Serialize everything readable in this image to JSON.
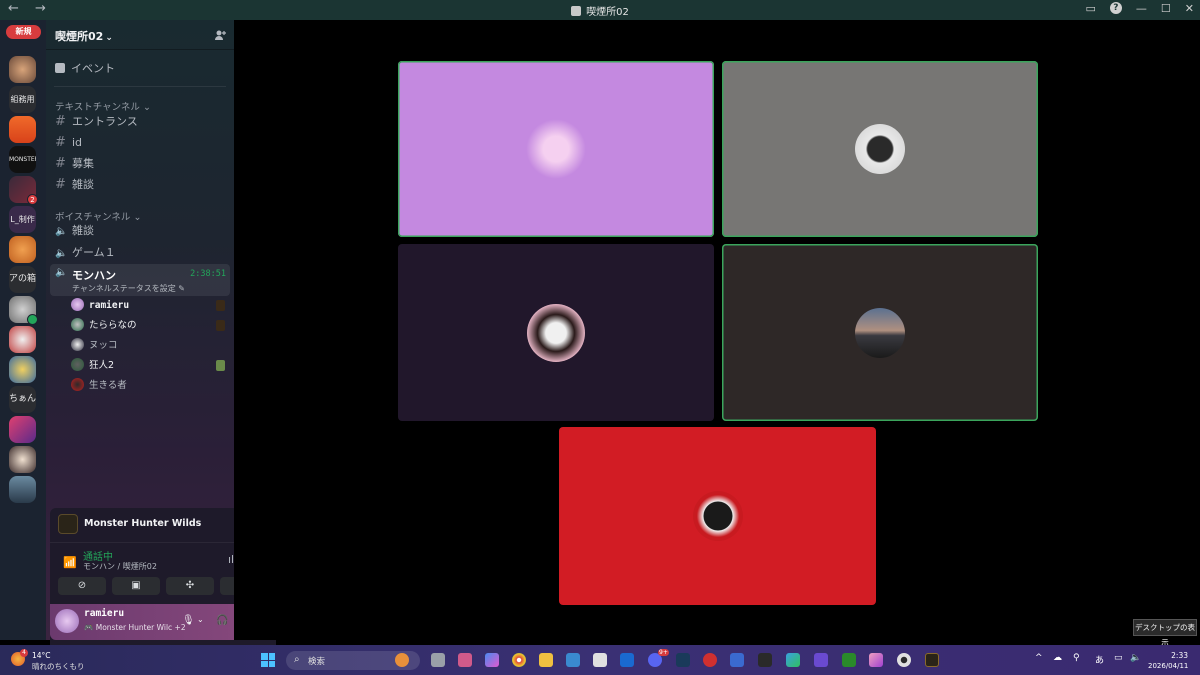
{
  "titlebar": {
    "nav": "← →",
    "title": "喫煙所02"
  },
  "servers": {
    "new_badge": "新規",
    "srv_3_text": "組務用サ",
    "srv_5_text": "MONSTER",
    "srv_7_text": "L_制作サ",
    "srv_10_text": "アの箱",
    "srv_14_text": "ちぁん",
    "badge_count": "2",
    "badge_count2": "4"
  },
  "sidebar": {
    "server_name": "喫煙所02",
    "chevron": "⌄",
    "event_label": "イベント",
    "text_category": "テキストチャンネル ⌄",
    "text_channels": [
      "エントランス",
      "id",
      "募集",
      "雑談"
    ],
    "voice_category": "ボイスチャンネル ⌄",
    "voice_channels": [
      "雑談",
      "ゲーム１"
    ],
    "active_voice": {
      "name": "モンハン",
      "timer": "2:38:51",
      "status": "チャンネルステータスを設定 ✎"
    },
    "voice_users": [
      "ramieru",
      "たららなの",
      "ヌッコ",
      "狂人2",
      "生きる者"
    ]
  },
  "game_panel": {
    "game_title": "Monster Hunter Wilds",
    "connected": "通話中",
    "channel_path": "モンハン / 喫煙所02",
    "user_name": "ramieru",
    "user_activity": "🎮 Monster Hunter Wilc +2"
  },
  "tooltip": "デスクトップの表示",
  "taskbar": {
    "temp": "14°C",
    "weather": "晴れのちくもり",
    "search_placeholder": "検索",
    "ime": "あ",
    "time": "2:33",
    "date": "2026/04/11",
    "discord_badge": "9+"
  },
  "colors": {
    "accent_green": "#23a55a",
    "tile_purple": "#c489e0",
    "tile_gray": "#777674",
    "tile_dark_purple": "#21172b",
    "tile_dark_brown": "#2e2827",
    "tile_red": "#d21c24"
  }
}
